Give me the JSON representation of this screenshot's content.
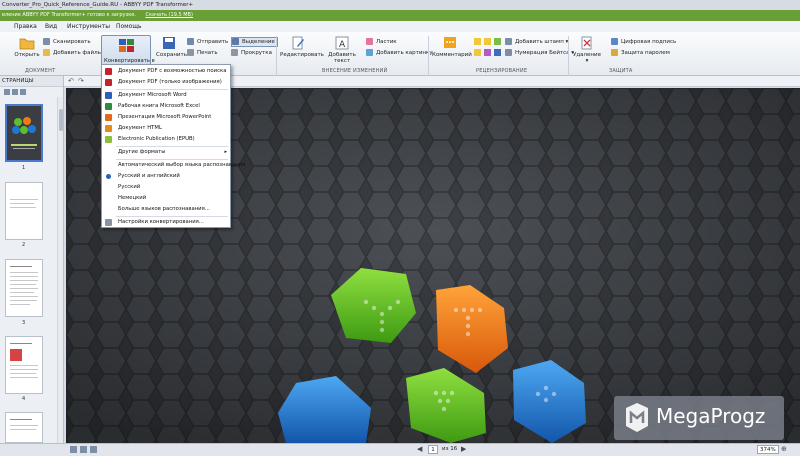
{
  "window": {
    "title": "Converter_Pro_Quick_Reference_Guide.RU - ABBYY PDF Transformer+"
  },
  "notification": {
    "text": "вление ABBYY PDF Transformer+ готово к загрузке.",
    "link": "Скачать (19,5 MB)"
  },
  "menu": {
    "items": [
      "Правка",
      "Вид",
      "Инструменты",
      "Помощь"
    ]
  },
  "ribbon": {
    "groups": {
      "document": "ДОКУМЕНТ",
      "changes": "ВНЕСЕНИЕ ИЗМЕНЕНИЙ",
      "review": "РЕЦЕНЗИРОВАНИЕ",
      "protection": "ЗАЩИТА"
    },
    "open": "Открыть",
    "scan": "Сканировать",
    "add_files": "Добавить файлы",
    "convert": "Конвертировать в",
    "save": "Сохранить",
    "send": "Отправить",
    "print": "Печать",
    "select": "Выделение",
    "scroll": "Прокрутка",
    "edit": "Редактировать",
    "add_text": "Добавить текст",
    "eraser": "Ластик",
    "add_picture": "Добавить картинку",
    "comment": "Комментарий",
    "add_stamp": "Добавить штамп",
    "bates": "Нумерация Бейтса",
    "delete": "Удаление",
    "signature": "Цифровая подпись",
    "password": "Защита паролем"
  },
  "pages_pane": {
    "title": "СТРАНИЦЫ",
    "page_numbers": [
      "1",
      "2",
      "3",
      "4"
    ]
  },
  "convert_menu": {
    "items": [
      "Документ PDF с возможностью поиска",
      "Документ PDF (только изображения)",
      "Документ Microsoft Word",
      "Рабочая книга Microsoft Excel",
      "Презентация Microsoft PowerPoint",
      "Документ HTML",
      "Electronic Publication (EPUB)",
      "Другие форматы",
      "Автоматический выбор языка распознавания",
      "Русский и английский",
      "Русский",
      "Немецкий",
      "Больше языков распознавания...",
      "Настройки конвертирования..."
    ]
  },
  "statusbar": {
    "page": "1",
    "of": "из 16",
    "zoom": "374%"
  },
  "watermark": {
    "text": "MegaProgz"
  },
  "colors": {
    "notify": "#6a9f36",
    "hex_green": "#5fbf2a",
    "hex_orange": "#f07a16",
    "hex_blue": "#1f78d0"
  }
}
